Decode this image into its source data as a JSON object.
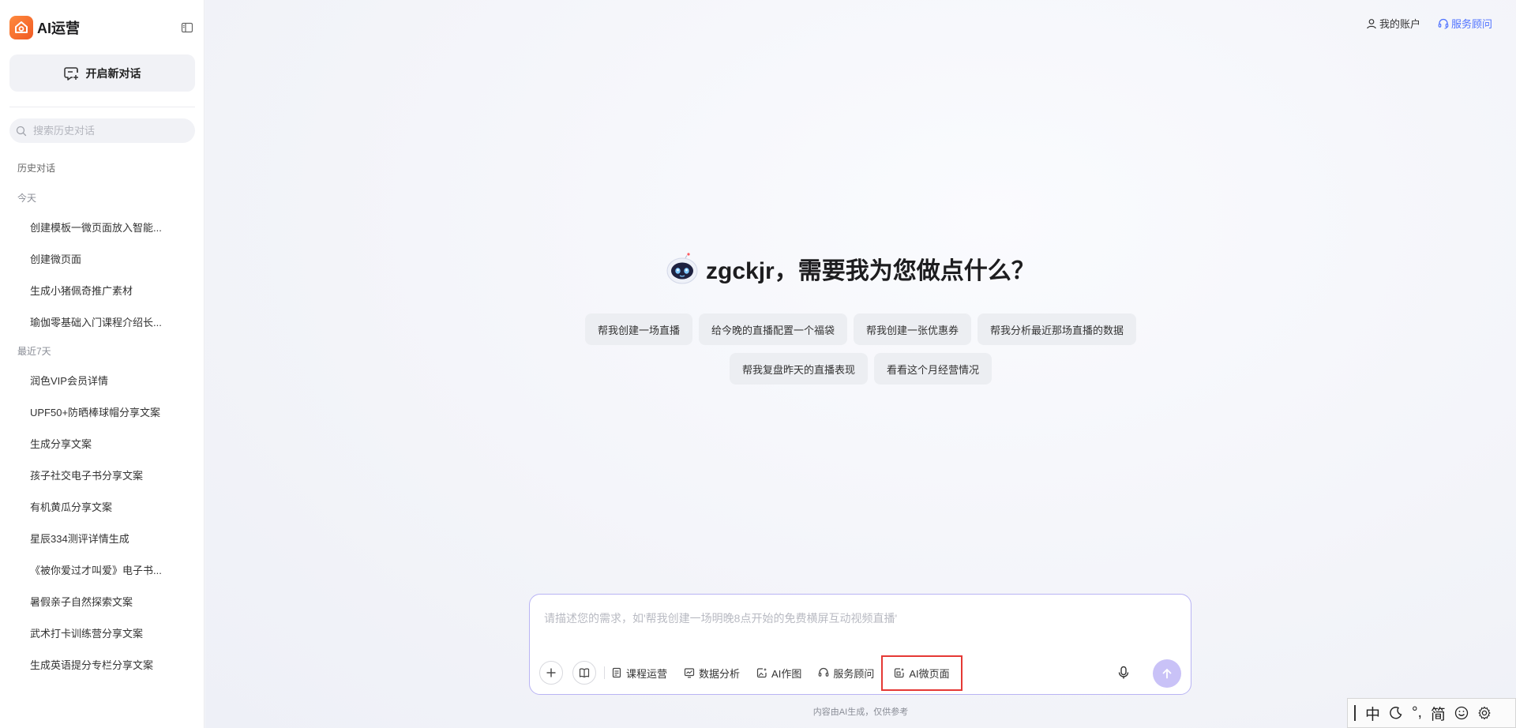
{
  "sidebar": {
    "logo_text": "AI运营",
    "new_chat_label": "开启新对话",
    "search_placeholder": "搜索历史对话",
    "history_title": "历史对话",
    "groups": [
      {
        "label": "今天",
        "items": [
          "创建模板一微页面放入智能...",
          "创建微页面",
          "生成小猪佩奇推广素材",
          "瑜伽零基础入门课程介绍长..."
        ]
      },
      {
        "label": "最近7天",
        "items": [
          "润色VIP会员详情",
          "UPF50+防晒棒球帽分享文案",
          "生成分享文案",
          "孩子社交电子书分享文案",
          "有机黄瓜分享文案",
          "星辰334测评详情生成",
          "《被你爱过才叫爱》电子书...",
          "暑假亲子自然探索文案",
          "武术打卡训练营分享文案",
          "生成英语提分专栏分享文案"
        ]
      }
    ]
  },
  "header": {
    "account_label": "我的账户",
    "advisor_label": "服务顾问"
  },
  "main": {
    "greeting": "zgckjr，需要我为您做点什么？",
    "suggestions_row1": [
      "帮我创建一场直播",
      "给今晚的直播配置一个福袋",
      "帮我创建一张优惠券",
      "帮我分析最近那场直播的数据"
    ],
    "suggestions_row2": [
      "帮我复盘昨天的直播表现",
      "看看这个月经营情况"
    ],
    "input_placeholder": "请描述您的需求，如'帮我创建一场明晚8点开始的免费横屏互动视频直播'",
    "tools": {
      "course": "课程运营",
      "data": "数据分析",
      "ai_image": "AI作图",
      "advisor": "服务顾问",
      "micro_page": "AI微页面"
    },
    "disclaimer": "内容由AI生成，仅供参考"
  },
  "ime": {
    "lang": "中",
    "punct": "°,",
    "simplified": "简"
  },
  "colors": {
    "brand_orange": "#f05a24",
    "accent_blue": "#4f72ff",
    "send_button": "#c9c2f7",
    "highlight_box": "#e53935"
  }
}
